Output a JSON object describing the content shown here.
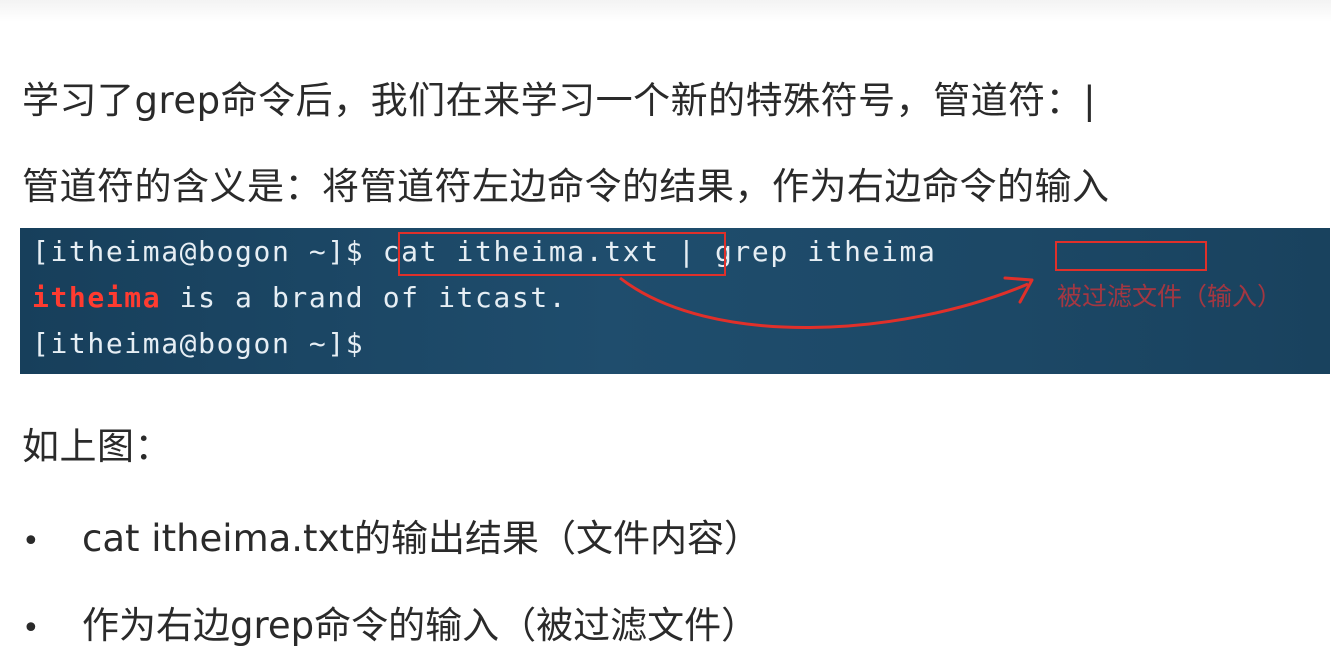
{
  "paragraphs": {
    "intro": "学习了grep命令后，我们在来学习一个新的特殊符号，管道符：|",
    "meaning": "管道符的含义是：将管道符左边命令的结果，作为右边命令的输入",
    "as_above": "如上图："
  },
  "terminal": {
    "line1_prompt": "[itheima@bogon ~]$ ",
    "line1_command": "cat itheima.txt",
    "line1_rest": " | grep itheima",
    "line2_match": "itheima",
    "line2_rest": " is a brand of itcast.",
    "line3_prompt": "[itheima@bogon ~]$",
    "annotation_label": "被过滤文件（输入）"
  },
  "bullets": [
    {
      "symbol": "•",
      "text": "cat itheima.txt的输出结果（文件内容）"
    },
    {
      "symbol": "•",
      "text": "作为右边grep命令的输入（被过滤文件）"
    }
  ],
  "colors": {
    "terminal_bg": "#1f4d6d",
    "highlight": "#ff3b30",
    "annotation": "#e0302a"
  }
}
